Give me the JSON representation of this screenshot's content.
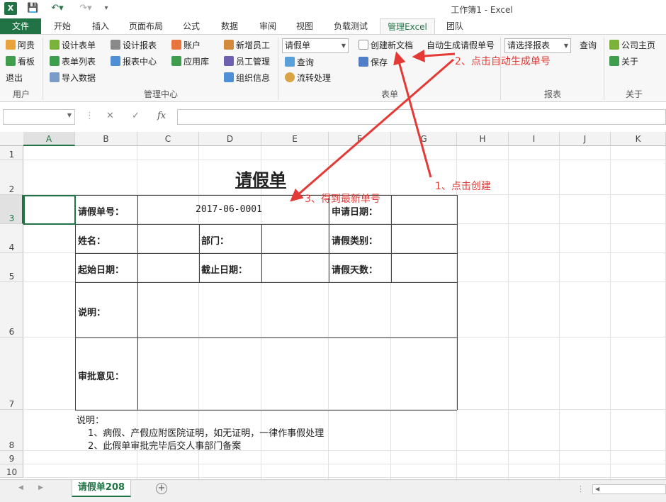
{
  "window": {
    "title": "工作簿1 - Excel",
    "app_icon": "excel-logo"
  },
  "qat": {
    "save": "save-icon",
    "undo": "undo-icon",
    "redo": "redo-icon"
  },
  "tabs": [
    "文件",
    "开始",
    "插入",
    "页面布局",
    "公式",
    "数据",
    "审阅",
    "视图",
    "负载测试",
    "管理Excel",
    "团队"
  ],
  "ribbon": {
    "user": {
      "items": [
        "阿贵",
        "看板",
        "退出"
      ],
      "group": "用户"
    },
    "mgmt": {
      "col1": [
        "设计表单",
        "表单列表",
        "导入数据"
      ],
      "col2": [
        "设计报表",
        "报表中心"
      ],
      "col3": [
        "账户",
        "应用库"
      ],
      "col4": [
        "新增员工",
        "员工管理",
        "组织信息"
      ],
      "group": "管理中心"
    },
    "form": {
      "select": "请假单",
      "query": "查询",
      "flow": "流转处理",
      "create": "创建新文档",
      "save": "保存",
      "autogen": "自动生成请假单号",
      "group": "表单"
    },
    "report": {
      "select": "请选择报表",
      "query": "查询",
      "group": "报表"
    },
    "about": {
      "home": "公司主页",
      "about": "关于",
      "group": "关于"
    }
  },
  "formula": {
    "cancel": "✕",
    "confirm": "✓",
    "fx": "fx",
    "value": ""
  },
  "columns": [
    "A",
    "B",
    "C",
    "D",
    "E",
    "F",
    "G",
    "H",
    "I",
    "J",
    "K"
  ],
  "rows": [
    "1",
    "2",
    "3",
    "4",
    "5",
    "6",
    "7",
    "8",
    "9",
    "10"
  ],
  "sheet": {
    "title": "请假单",
    "form_no_label": "请假单号：",
    "form_no": "2017-06-0001",
    "apply_date": "申请日期：",
    "name": "姓名：",
    "dept": "部门：",
    "leave_type": "请假类别：",
    "start": "起始日期：",
    "end": "截止日期：",
    "days": "请假天数：",
    "desc": "说明：",
    "approval": "审批意见：",
    "note_title": "说明：",
    "note1": "1、病假、产假应附医院证明，如无证明，一律作事假处理",
    "note2": "2、此假单审批完毕后交人事部门备案"
  },
  "sheet_tab": "请假单208",
  "annotations": {
    "a1": "1、点击创建",
    "a2": "2、点击自动生成单号",
    "a3": "3、得到最新单号"
  }
}
